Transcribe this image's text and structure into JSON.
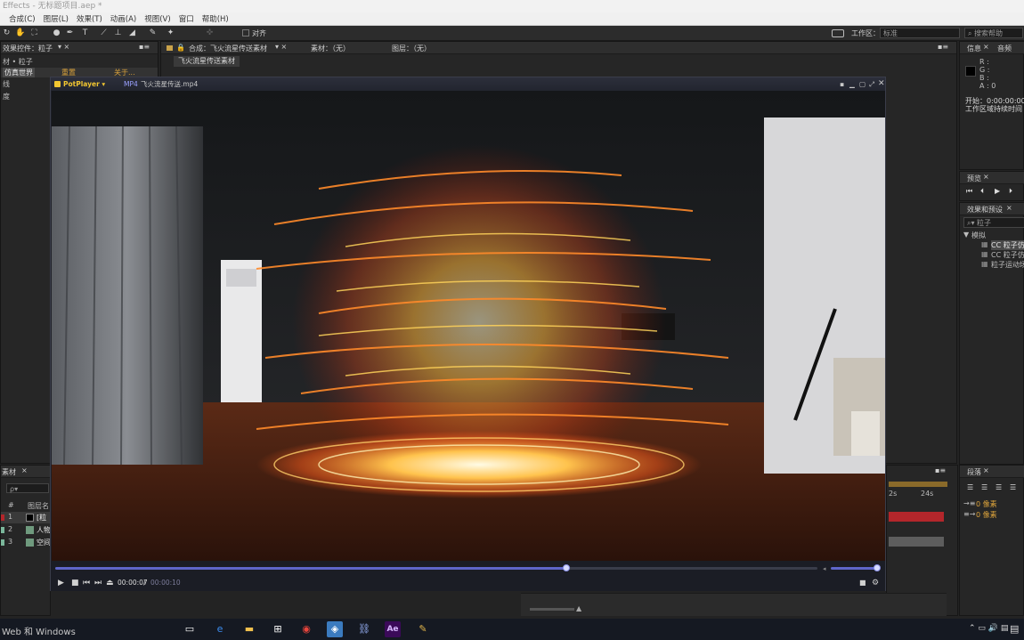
{
  "app": {
    "title": "Effects - 无标题项目.aep *",
    "menu": [
      "合成(C)",
      "图层(L)",
      "效果(T)",
      "动画(A)",
      "视图(V)",
      "窗口",
      "帮助(H)"
    ]
  },
  "toolbar": {
    "align_label": "对齐",
    "workspace_label": "工作区：",
    "workspace_value": "标准",
    "search_placeholder": "搜索帮助"
  },
  "effects_panel": {
    "tab": "效果控件：粒子",
    "subtitle": "材 • 粒子",
    "item_label": "仿真世界",
    "item_reset": "重置",
    "item_about": "关于...",
    "lines": [
      "线",
      "度"
    ]
  },
  "composition_panel": {
    "tab": "合成：飞火流星传送素材",
    "footage_tab": "素材：（无）",
    "layer_tab": "图层：（无）",
    "subtab": "飞火流星传送素材"
  },
  "info_panel": {
    "tabs": [
      "信息",
      "音频"
    ],
    "channels": [
      "R :",
      "G :",
      "B :",
      "A : 0"
    ],
    "start_label": "开始：0:00:00:00，",
    "duration_label": "工作区域持续时间"
  },
  "preview_panel": {
    "tab": "预览"
  },
  "effects_presets_panel": {
    "tab": "效果和预设",
    "search_value": "粒子",
    "category": "模拟",
    "items": [
      "CC 粒子仿",
      "CC 粒子仿",
      "粒子运动场"
    ]
  },
  "paragraph_panel": {
    "tab": "段落",
    "unit_1": "0 像素",
    "unit_2": "0 像素"
  },
  "project_panel": {
    "tab": "素材",
    "search_placeholder": "ρ▾",
    "column_header": "图层名",
    "rows": [
      {
        "num": "1",
        "name": "[粒"
      },
      {
        "num": "2",
        "name": "人物"
      },
      {
        "num": "3",
        "name": "空间"
      }
    ]
  },
  "timeline": {
    "ruler_2s": "2s",
    "ruler_24s": "24s"
  },
  "player": {
    "brand": "PotPlayer ▾",
    "format": "MP4",
    "filename": "飞火流星传送.mp4",
    "current_time": "00:00:07",
    "separator": " / ",
    "total_time": "00:00:10",
    "progress": 0.67
  },
  "taskbar": {
    "search_text": "Web 和 Windows"
  },
  "colors": {
    "accent": "#5f66c9",
    "ae_purple": "#3b0a59",
    "highlight_red": "#b3262b"
  }
}
